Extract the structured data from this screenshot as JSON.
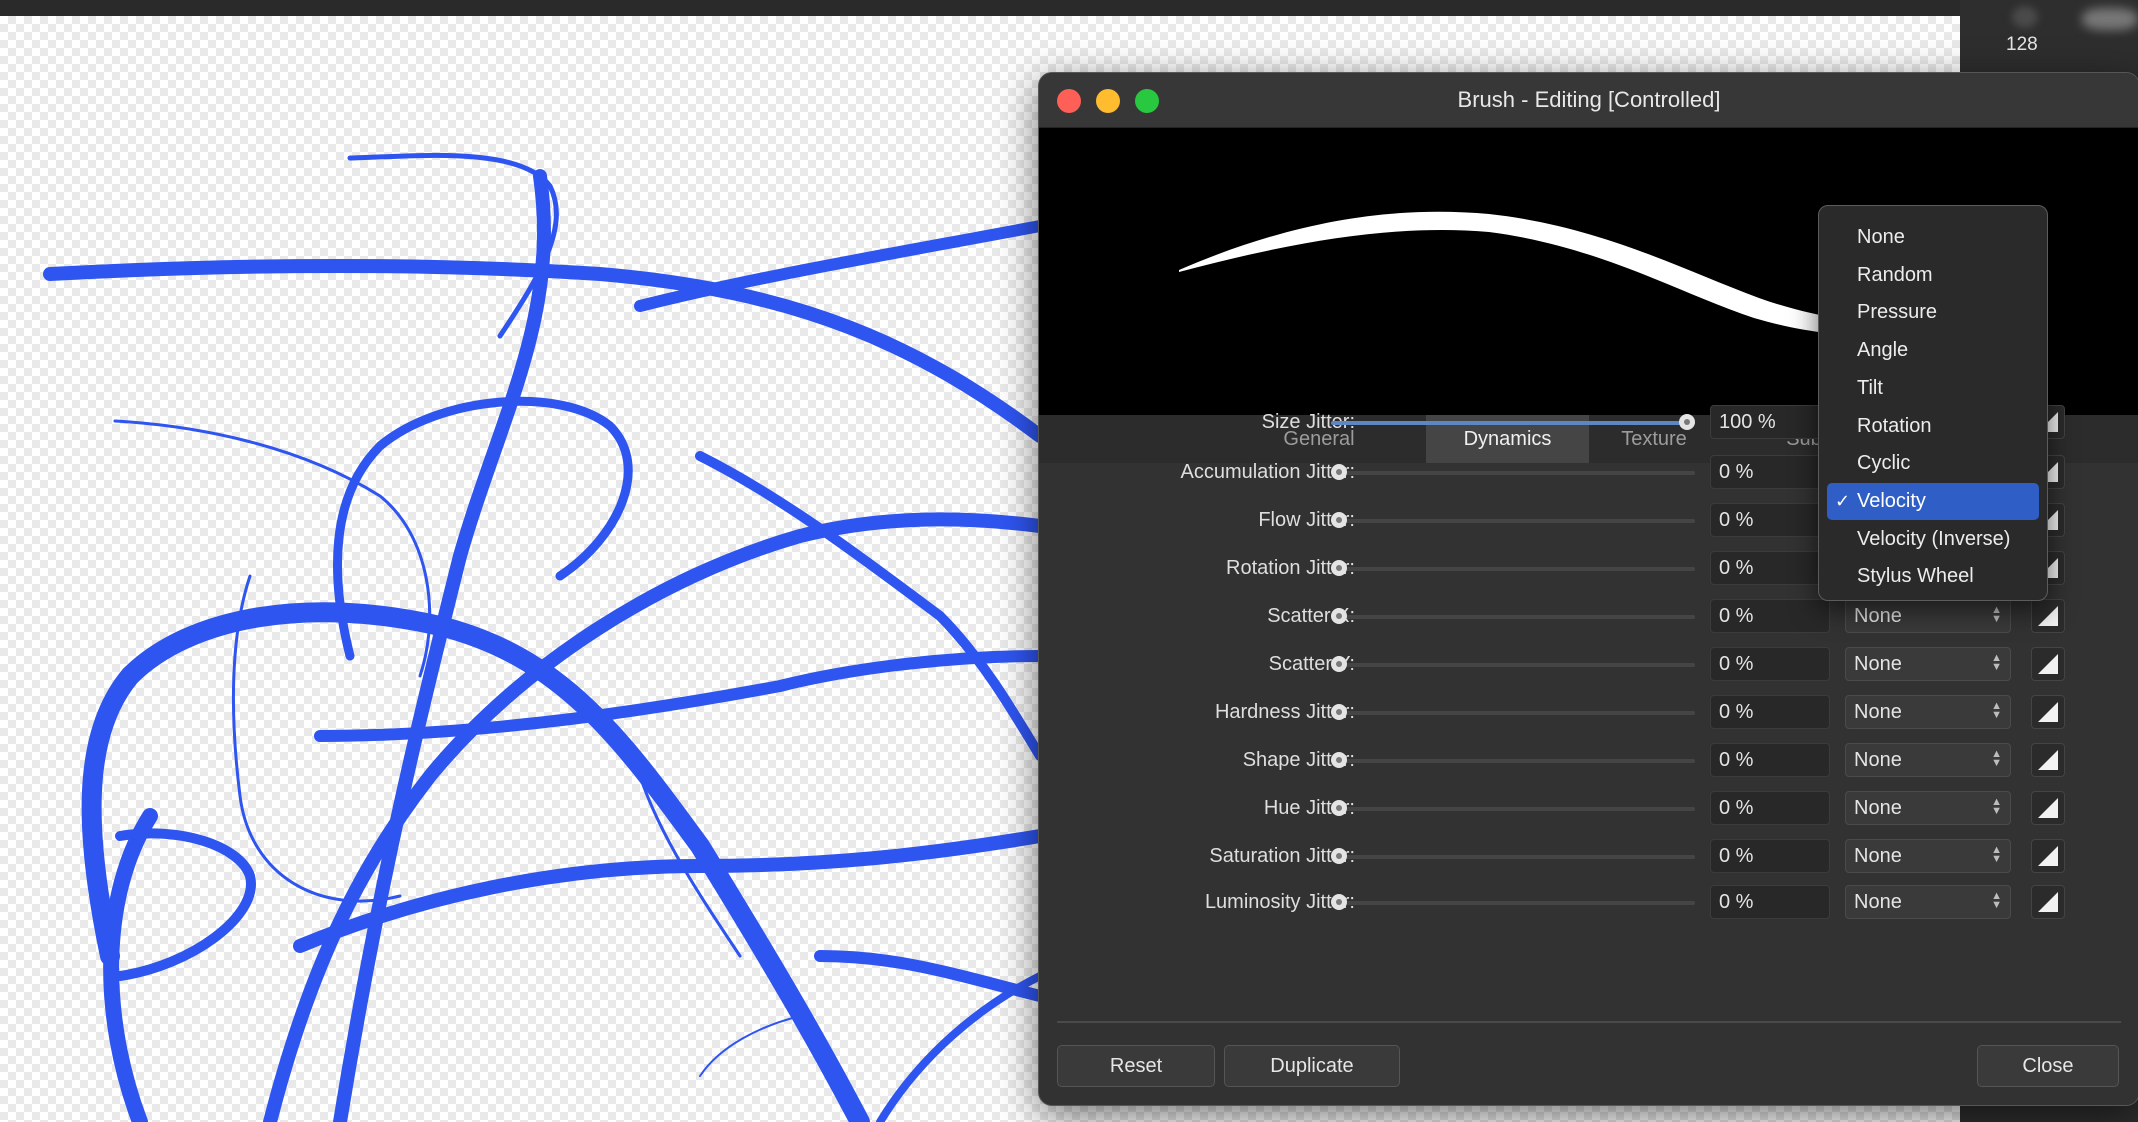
{
  "side_panel": {
    "value": "128"
  },
  "dialog": {
    "title": "Brush - Editing [Controlled]",
    "tabs": [
      {
        "label": "General",
        "active": false
      },
      {
        "label": "Dynamics",
        "active": true
      },
      {
        "label": "Texture",
        "active": false
      },
      {
        "label": "Sub",
        "active": false
      }
    ],
    "rows": [
      {
        "label": "Size Jitter:",
        "value": "100 %",
        "slider_fraction": 1.0,
        "controller": "Velocity"
      },
      {
        "label": "Accumulation Jitter:",
        "value": "0 %",
        "slider_fraction": 0,
        "controller": "None"
      },
      {
        "label": "Flow Jitter:",
        "value": "0 %",
        "slider_fraction": 0,
        "controller": "None"
      },
      {
        "label": "Rotation Jitter:",
        "value": "0 %",
        "slider_fraction": 0,
        "controller": "None"
      },
      {
        "label": "Scatter X:",
        "value": "0 %",
        "slider_fraction": 0,
        "controller": "None"
      },
      {
        "label": "Scatter Y:",
        "value": "0 %",
        "slider_fraction": 0,
        "controller": "None"
      },
      {
        "label": "Hardness Jitter:",
        "value": "0 %",
        "slider_fraction": 0,
        "controller": "None"
      },
      {
        "label": "Shape Jitter:",
        "value": "0 %",
        "slider_fraction": 0,
        "controller": "None"
      },
      {
        "label": "Hue Jitter:",
        "value": "0 %",
        "slider_fraction": 0,
        "controller": "None"
      },
      {
        "label": "Saturation Jitter:",
        "value": "0 %",
        "slider_fraction": 0,
        "controller": "None"
      },
      {
        "label": "Luminosity Jitter:",
        "value": "0 %",
        "slider_fraction": 0,
        "controller": "None"
      }
    ],
    "buttons": {
      "reset": "Reset",
      "duplicate": "Duplicate",
      "close": "Close"
    }
  },
  "dropdown": {
    "items": [
      "None",
      "Random",
      "Pressure",
      "Angle",
      "Tilt",
      "Rotation",
      "Cyclic",
      "Velocity",
      "Velocity (Inverse)",
      "Stylus Wheel"
    ],
    "selected": "Velocity",
    "check": "✓"
  },
  "colors": {
    "stroke_blue": "#2f55f0",
    "accent_selected": "#2f5fc6",
    "slider_fill": "#5d86c2",
    "traffic_red": "#fe5f57",
    "traffic_yellow": "#febc2e",
    "traffic_green": "#28c840"
  },
  "icons": {
    "controller_curve": "pressure-curve-icon",
    "select_arrows": "up-down-chevron-icon",
    "checkmark": "checkmark-icon"
  }
}
